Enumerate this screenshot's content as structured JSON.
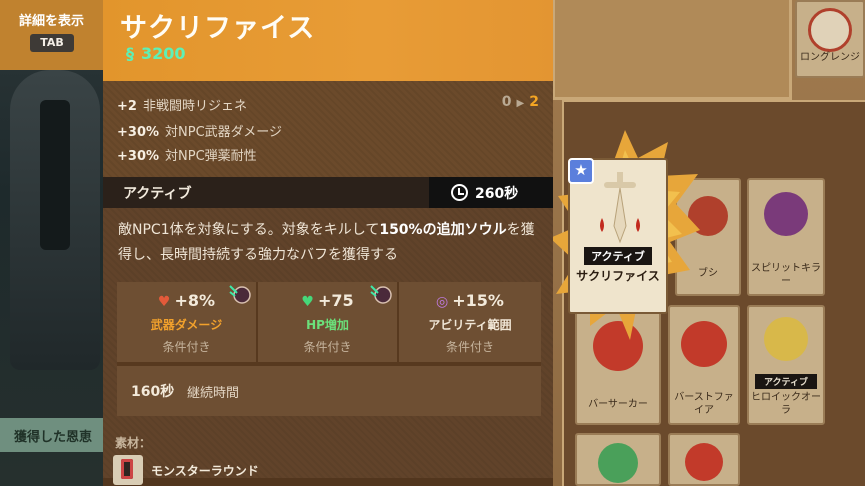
{
  "detail_toggle": {
    "label": "詳細を表示",
    "key": "TAB"
  },
  "item": {
    "title": "サクリファイス",
    "cost": "3200",
    "cost_icon": "soul-icon"
  },
  "stats": [
    {
      "value": "+2",
      "label": "非戦闘時リジェネ",
      "progress_from": "0",
      "progress_to": "2"
    },
    {
      "value": "+30%",
      "label": "対NPC武器ダメージ"
    },
    {
      "value": "+30%",
      "label": "対NPC弾薬耐性"
    }
  ],
  "active": {
    "label": "アクティブ",
    "cooldown": "260秒"
  },
  "description": {
    "part1": "敵NPC1体を対象にする。対象をキルして",
    "bold1": "150%の追加ソウル",
    "part2": "を獲得し、長時間持続する強力なバフを獲得する"
  },
  "effects": [
    {
      "value": "+8%",
      "name": "武器ダメージ",
      "condition": "条件付き",
      "color": "#f2a12c",
      "icon": "weapon-damage-icon"
    },
    {
      "value": "+75",
      "name": "HP増加",
      "condition": "条件付き",
      "color": "#6be07a",
      "icon": "heart-icon"
    },
    {
      "value": "+15%",
      "name": "アビリティ範囲",
      "condition": "条件付き",
      "color": "#f0e6d6",
      "icon": "ability-range-icon"
    }
  ],
  "duration": {
    "value": "160秒",
    "label": "継続時間"
  },
  "materials": {
    "label": "素材：",
    "item": "モンスターラウンド"
  },
  "background": {
    "reward_label": "獲得した恩恵",
    "top_card_label": "ロングレンジ",
    "featured_card": {
      "tag": "アクティブ",
      "name": "サクリファイス"
    },
    "grid_cards": [
      {
        "label": "スピリットキラー",
        "tag": ""
      },
      {
        "label": "ヒロイックオーラ",
        "tag": "アクティブ"
      },
      {
        "label": "バーサーカー",
        "tag": ""
      },
      {
        "label": "バーストファイア",
        "tag": ""
      },
      {
        "label": "ブシ",
        "tag": ""
      }
    ]
  },
  "colors": {
    "header": "#e39532",
    "panel": "#52361e",
    "accent_soul": "#5ef0b6",
    "progress_to": "#f5a623"
  }
}
